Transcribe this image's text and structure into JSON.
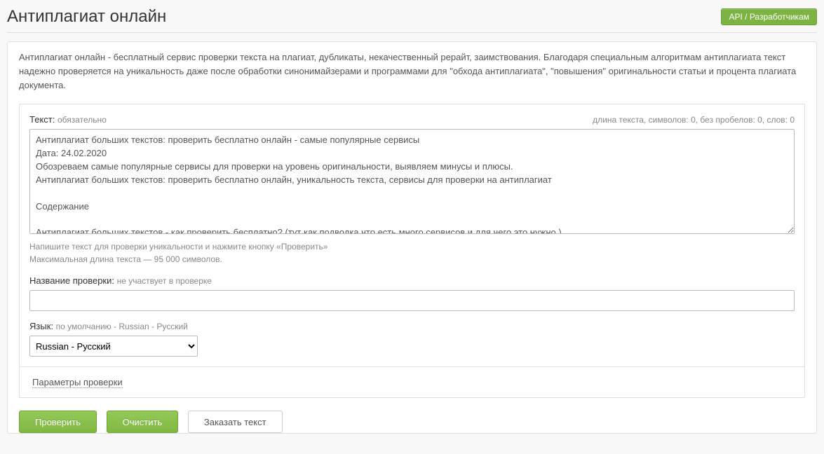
{
  "header": {
    "title": "Антиплагиат онлайн",
    "api_btn": "API / Разработчикам"
  },
  "intro": "Антиплагиат онлайн - бесплатный сервис проверки текста на плагиат, дубликаты, некачественный рерайт, заимствования. Благодаря специальным алгоритмам антиплагиата текст надежно проверяется на уникальность даже после обработки синонимайзерами и программами для \"обхода антиплагиата\", \"повышения\" оригинальности статьи и процента плагиата документа.",
  "text_field": {
    "label": "Текст:",
    "required_hint": "обязательно",
    "counter": "длина текста, символов: 0, без пробелов: 0, слов: 0",
    "value": "Антиплагиат больших текстов: проверить бесплатно онлайн - самые популярные сервисы\nДата: 24.02.2020\nОбозреваем самые популярные сервисы для проверки на уровень оригинальности, выявляем минусы и плюсы.\nАнтиплагиат больших текстов: проверить бесплатно онлайн, уникальность текста, сервисы для проверки на антиплагиат\n\nСодержание\n\nАнтиплагиат больших текстов - как проверить бесплатно? (тут как подводка что есть много сервисов и для чего это нужно )",
    "help_line1": "Напишите текст для проверки уникальности и нажмите кнопку «Проверить»",
    "help_line2": "Максимальная длина текста — 95 000 символов."
  },
  "title_field": {
    "label": "Название проверки:",
    "hint": "не участвует в проверке",
    "value": ""
  },
  "lang_field": {
    "label": "Язык:",
    "hint": "по умолчанию - Russian - Русский",
    "selected": "Russian - Русский"
  },
  "params_link": "Параметры проверки",
  "buttons": {
    "check": "Проверить",
    "clear": "Очистить",
    "order": "Заказать текст"
  }
}
